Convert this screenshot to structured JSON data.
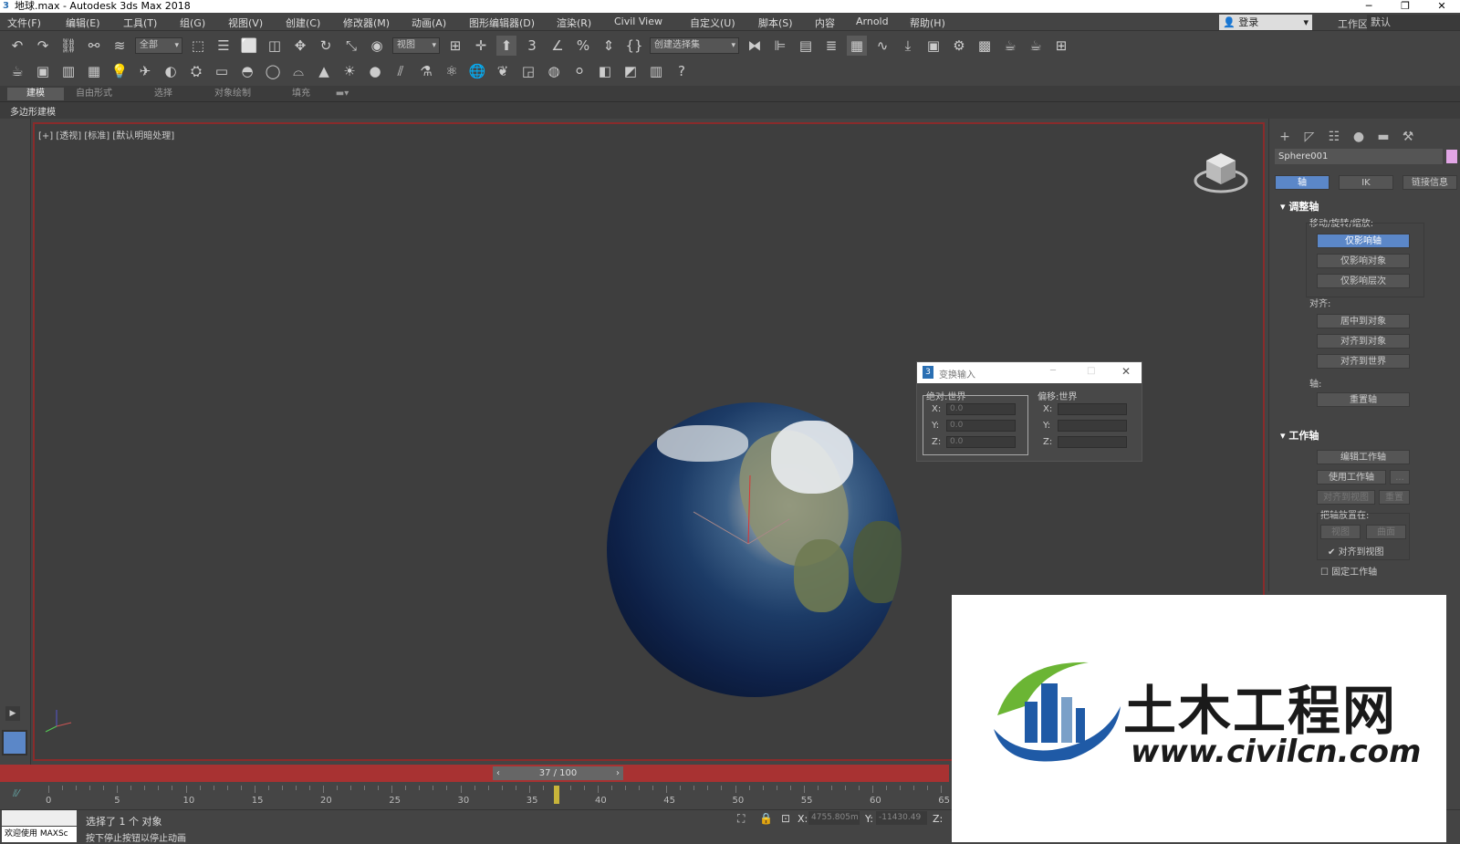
{
  "window": {
    "title": "地球.max - Autodesk 3ds Max 2018",
    "minimize": "─",
    "restore": "❐",
    "close": "✕"
  },
  "menus": [
    "文件(F)",
    "编辑(E)",
    "工具(T)",
    "组(G)",
    "视图(V)",
    "创建(C)",
    "修改器(M)",
    "动画(A)",
    "图形编辑器(D)",
    "渲染(R)",
    "Civil View",
    "自定义(U)",
    "脚本(S)",
    "内容",
    "Arnold",
    "帮助(H)"
  ],
  "account": {
    "login": "登录",
    "workspace_label": "工作区:",
    "workspace_value": "默认"
  },
  "toolbar": {
    "selection_filter": "全部",
    "ref_coord": "视图",
    "selection_set": "创建选择集"
  },
  "ribbon": {
    "tabs": [
      "建模",
      "自由形式",
      "选择",
      "对象绘制",
      "填充"
    ],
    "active": "建模",
    "panel": "多边形建模"
  },
  "viewport": {
    "label": "[+] [透视] [标准] [默认明暗处理]"
  },
  "command_panel": {
    "object_name": "Sphere001",
    "object_color": "#e2a6e6",
    "tabs": [
      "轴",
      "IK",
      "链接信息"
    ],
    "rollout_adjust": {
      "title": "调整轴",
      "move_group": "移动/旋转/缩放:",
      "btn_pivot": "仅影响轴",
      "btn_object": "仅影响对象",
      "btn_hier": "仅影响层次",
      "align_group": "对齐:",
      "btn_center": "居中到对象",
      "btn_align_obj": "对齐到对象",
      "btn_align_world": "对齐到世界",
      "pivot_group": "轴:",
      "btn_reset": "重置轴"
    },
    "rollout_working": {
      "title": "工作轴",
      "btn_edit": "编辑工作轴",
      "btn_use": "使用工作轴",
      "btn_more": "...",
      "btn_align_view": "对齐到视图",
      "btn_reset": "重置",
      "place_group": "把轴放置在:",
      "btn_view": "视图",
      "btn_surface": "曲面",
      "chk_align_view": "对齐到视图",
      "chk_lock": "固定工作轴"
    }
  },
  "dialog": {
    "title": "变换输入",
    "abs_label": "绝对:世界",
    "off_label": "偏移:世界",
    "abs": {
      "x": "0.0",
      "y": "0.0",
      "z": "0.0"
    },
    "axis_x": "X:",
    "axis_y": "Y:",
    "axis_z": "Z:"
  },
  "timeline": {
    "frame": "37 / 100",
    "current": 37,
    "ticks": [
      "0",
      "5",
      "10",
      "15",
      "20",
      "25",
      "30",
      "35",
      "40",
      "45",
      "50",
      "55",
      "60",
      "65"
    ]
  },
  "status": {
    "selected": "选择了 1 个 对象",
    "hint": "按下停止按钮以停止动画",
    "welcome": "欢迎使用 MAXSc",
    "x_label": "X:",
    "x_value": "4755.805m",
    "y_label": "Y:",
    "y_value": "-11430.49",
    "z_label": "Z:"
  },
  "watermark": {
    "title": "土木工程网",
    "url": "www.civilcn.com"
  }
}
